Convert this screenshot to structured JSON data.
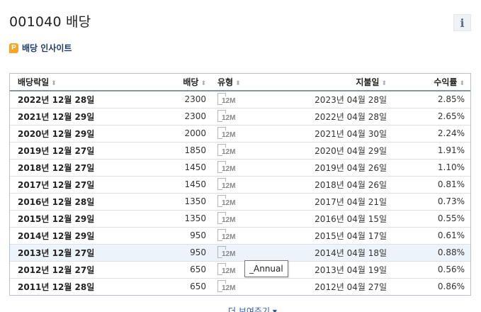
{
  "header": {
    "title": "001040 배당",
    "info_label": "i"
  },
  "insight": {
    "icon_text": "P",
    "label": "배당 인사이트"
  },
  "table": {
    "columns": {
      "ex_date": "배당락일",
      "dividend": "배당",
      "type": "유형",
      "pay_date": "지불일",
      "yield": "수익률",
      "sort_icon": "⬍"
    },
    "rows": [
      {
        "ex_date": "2022년 12월 28일",
        "dividend": "2300",
        "type": "12M",
        "pay_date": "2023년 04월 28일",
        "yield": "2.85%"
      },
      {
        "ex_date": "2021년 12월 29일",
        "dividend": "2300",
        "type": "12M",
        "pay_date": "2022년 04월 28일",
        "yield": "2.65%"
      },
      {
        "ex_date": "2020년 12월 29일",
        "dividend": "2000",
        "type": "12M",
        "pay_date": "2021년 04월 30일",
        "yield": "2.24%"
      },
      {
        "ex_date": "2019년 12월 27일",
        "dividend": "1850",
        "type": "12M",
        "pay_date": "2020년 04월 29일",
        "yield": "1.91%"
      },
      {
        "ex_date": "2018년 12월 27일",
        "dividend": "1450",
        "type": "12M",
        "pay_date": "2019년 04월 26일",
        "yield": "1.10%"
      },
      {
        "ex_date": "2017년 12월 27일",
        "dividend": "1450",
        "type": "12M",
        "pay_date": "2018년 04월 26일",
        "yield": "0.81%"
      },
      {
        "ex_date": "2016년 12월 28일",
        "dividend": "1350",
        "type": "12M",
        "pay_date": "2017년 04월 21일",
        "yield": "0.73%"
      },
      {
        "ex_date": "2015년 12월 29일",
        "dividend": "1350",
        "type": "12M",
        "pay_date": "2016년 04월 15일",
        "yield": "0.55%"
      },
      {
        "ex_date": "2014년 12월 29일",
        "dividend": "950",
        "type": "12M",
        "pay_date": "2015년 04월 17일",
        "yield": "0.61%"
      },
      {
        "ex_date": "2013년 12월 27일",
        "dividend": "950",
        "type": "12M",
        "pay_date": "2014년 04월 18일",
        "yield": "0.88%"
      },
      {
        "ex_date": "2012년 12월 27일",
        "dividend": "650",
        "type": "12M",
        "pay_date": "2013년 04월 19일",
        "yield": "0.56%"
      },
      {
        "ex_date": "2011년 12월 28일",
        "dividend": "650",
        "type": "12M",
        "pay_date": "2012년 04월 27일",
        "yield": "0.86%"
      }
    ],
    "highlighted_row": 9
  },
  "tooltip": {
    "text": "_Annual"
  },
  "footer": {
    "more_label": "더 보여주기 ▾"
  }
}
